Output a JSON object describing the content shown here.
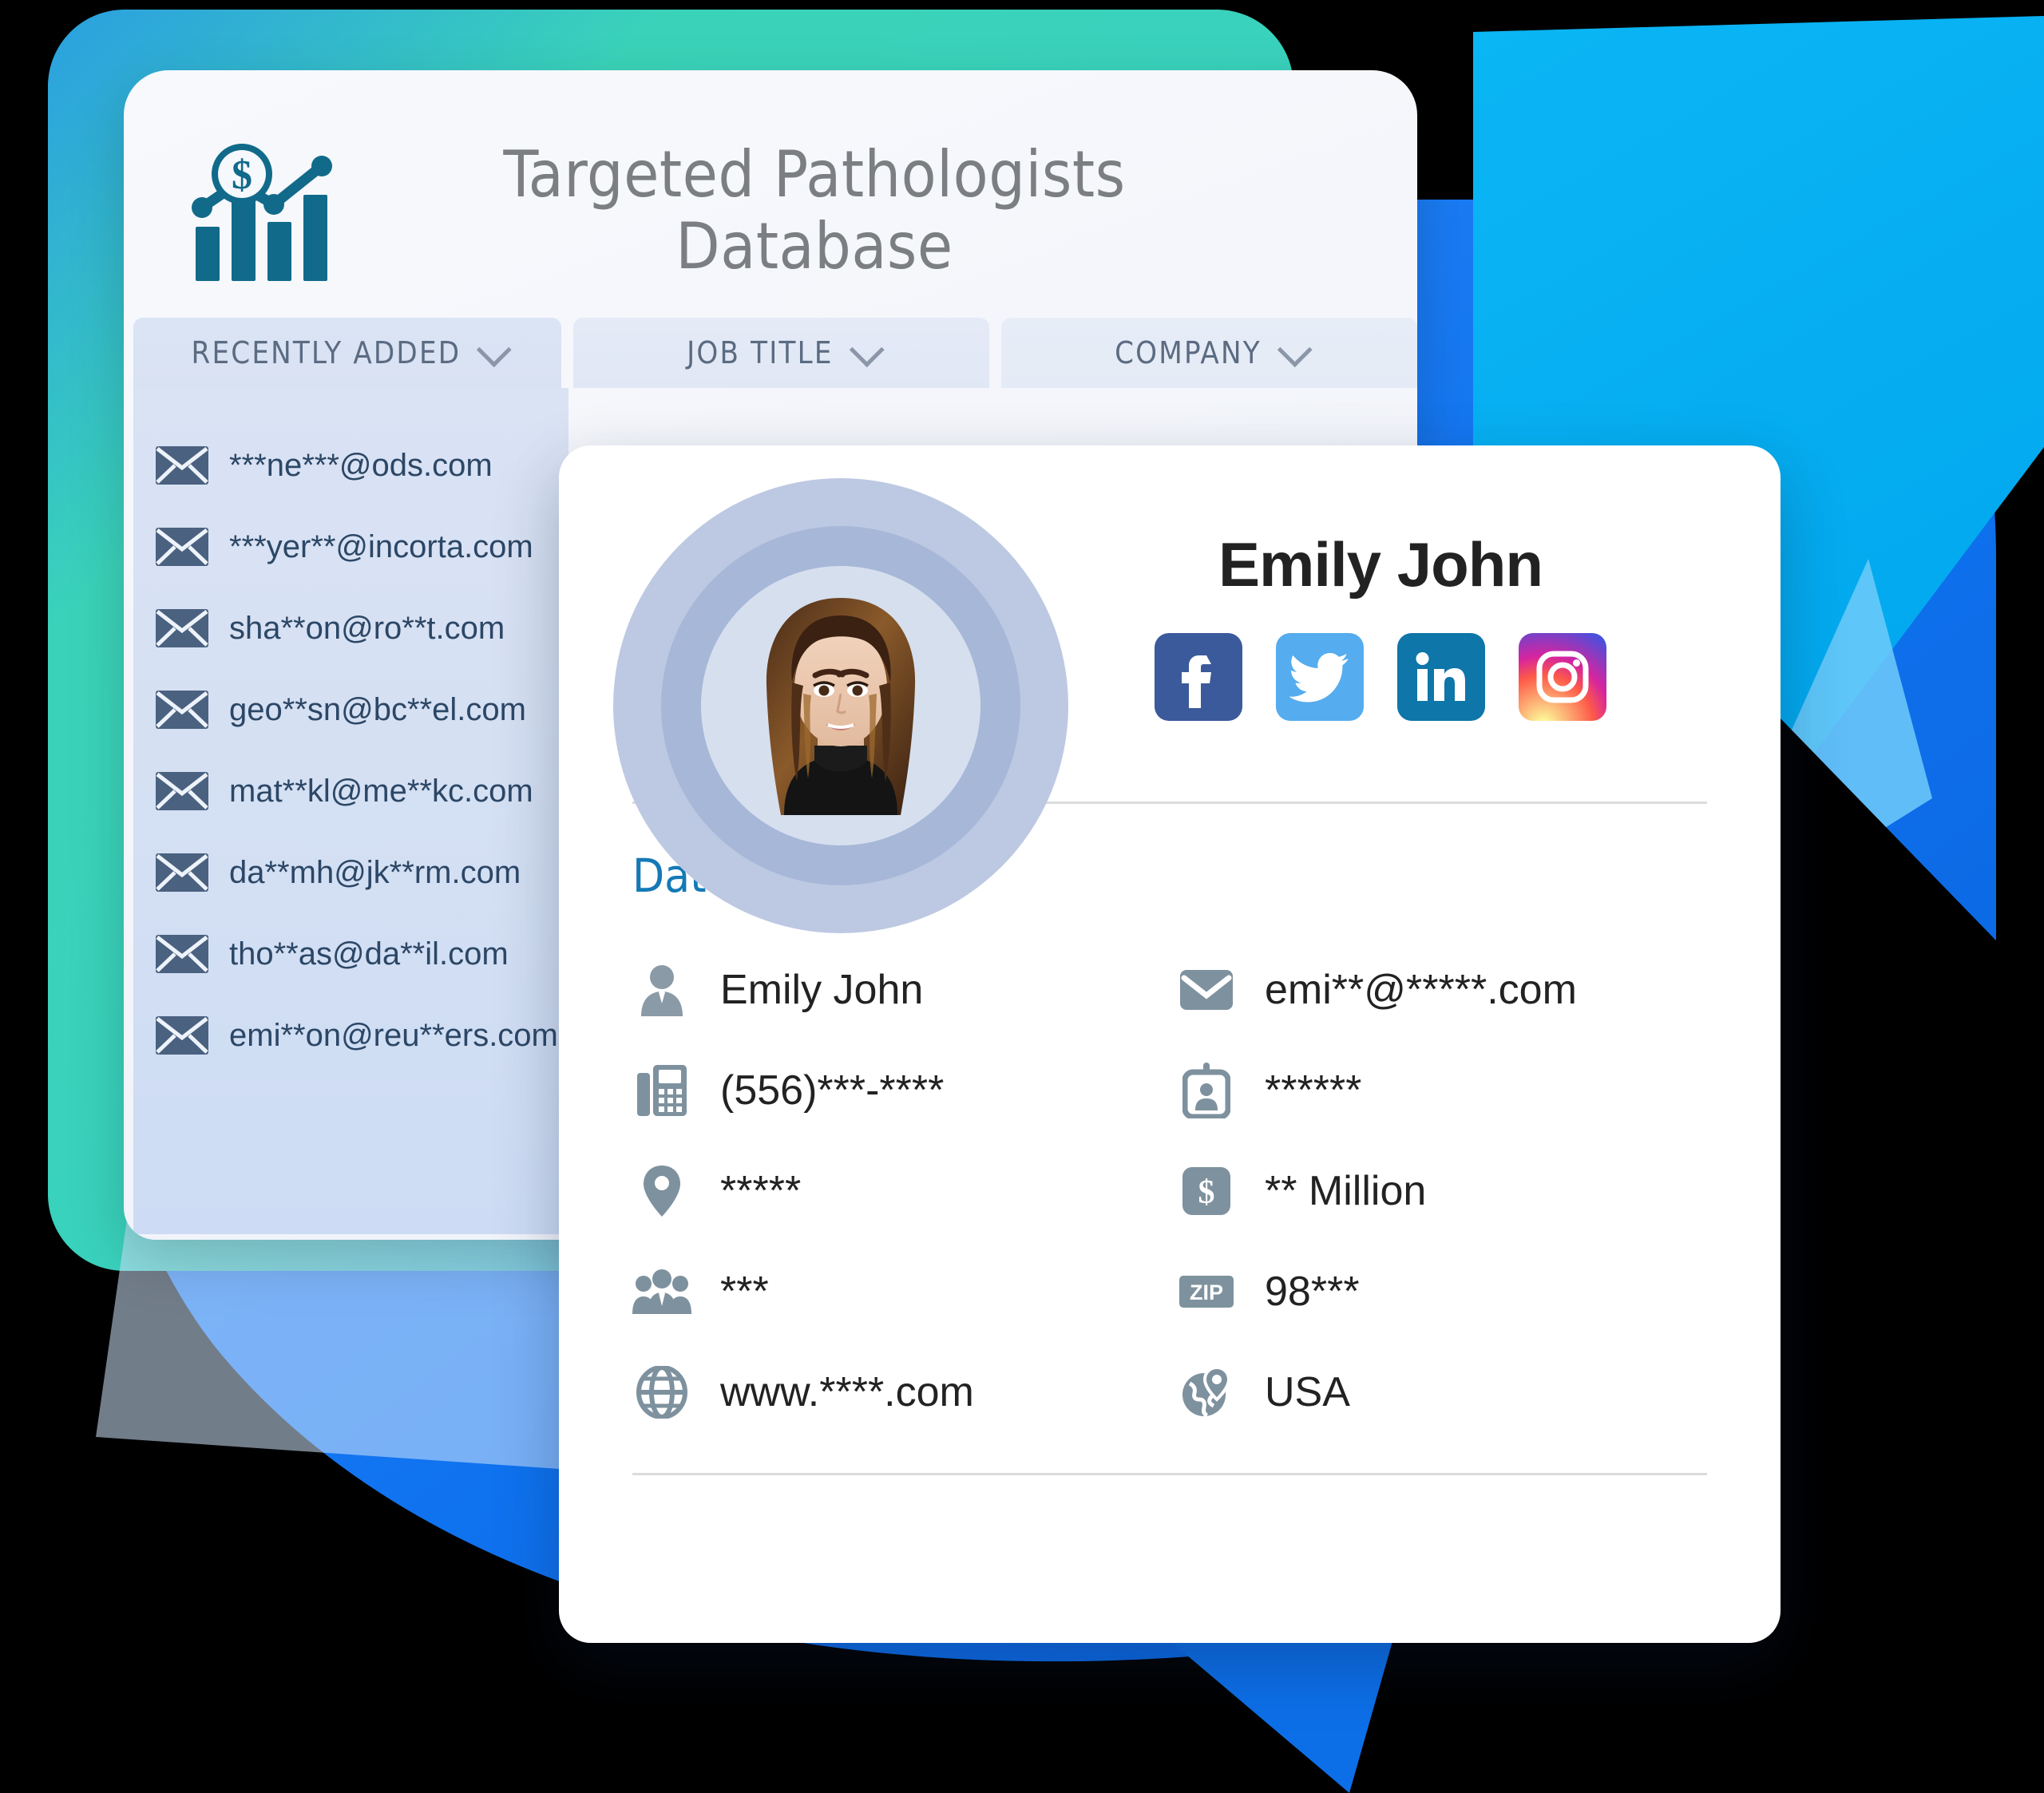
{
  "colors": {
    "cyan_shape": "#00AEEF",
    "blue_circle": "#0d6fe8",
    "teal_backdrop": "#3fd9b0",
    "accent_blue": "#1579b6",
    "logo_teal": "#116a8a",
    "icon_gray": "#7e919e",
    "envelope_blue": "#4a6180",
    "facebook": "#3b5a9b",
    "twitter": "#55acee",
    "linkedin": "#0e76a8",
    "instagram": "#d6249f"
  },
  "database_card": {
    "logo_icon": "bar-chart-dollar-icon",
    "title": "Targeted Pathologists Database",
    "title_line1": "Targeted Pathologists",
    "title_line2": "Database",
    "tabs": [
      {
        "label": "RECENTLY ADDED",
        "icon": "chevron-down-icon",
        "active": true
      },
      {
        "label": "JOB TITLE",
        "icon": "chevron-down-icon",
        "active": false
      },
      {
        "label": "COMPANY",
        "icon": "chevron-down-icon",
        "active": false
      }
    ],
    "email_list": [
      {
        "icon": "envelope-icon",
        "email": "***ne***@ods.com"
      },
      {
        "icon": "envelope-icon",
        "email": "***yer**@incorta.com"
      },
      {
        "icon": "envelope-icon",
        "email": "sha**on@ro**t.com"
      },
      {
        "icon": "envelope-icon",
        "email": "geo**sn@bc**el.com"
      },
      {
        "icon": "envelope-icon",
        "email": "mat**kl@me**kc.com"
      },
      {
        "icon": "envelope-icon",
        "email": "da**mh@jk**rm.com"
      },
      {
        "icon": "envelope-icon",
        "email": "tho**as@da**il.com"
      },
      {
        "icon": "envelope-icon",
        "email": "emi**on@reu**ers.com"
      }
    ]
  },
  "profile_card": {
    "avatar": "profile-photo",
    "name": "Emily John",
    "socials": [
      {
        "name": "facebook-icon",
        "label": "Facebook"
      },
      {
        "name": "twitter-icon",
        "label": "Twitter"
      },
      {
        "name": "linkedin-icon",
        "label": "LinkedIn"
      },
      {
        "name": "instagram-icon",
        "label": "Instagram"
      }
    ],
    "segments_title": "Data segments",
    "segments": [
      {
        "icon": "person-icon",
        "value": "Emily John"
      },
      {
        "icon": "envelope-icon",
        "value": "emi**@*****.com"
      },
      {
        "icon": "fax-phone-icon",
        "value": "(556)***-****"
      },
      {
        "icon": "id-badge-icon",
        "value": "******"
      },
      {
        "icon": "location-pin-icon",
        "value": "*****"
      },
      {
        "icon": "dollar-square-icon",
        "value": "** Million"
      },
      {
        "icon": "people-group-icon",
        "value": "***"
      },
      {
        "icon": "zip-badge-icon",
        "value": "98***"
      },
      {
        "icon": "globe-icon",
        "value": "www.****.com"
      },
      {
        "icon": "globe-pin-icon",
        "value": "USA"
      }
    ]
  }
}
